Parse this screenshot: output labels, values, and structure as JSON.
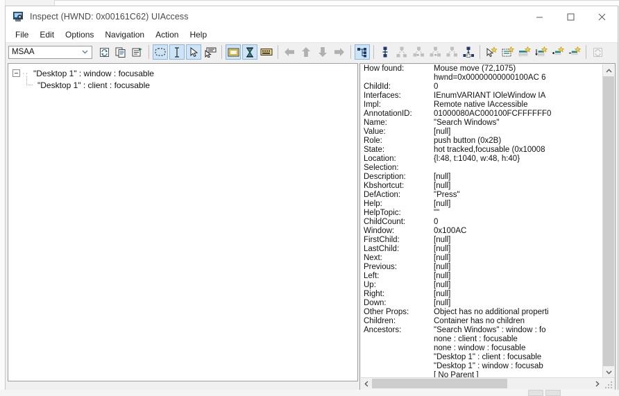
{
  "window": {
    "title": "Inspect  (HWND: 0x00161C62) UIAccess",
    "icon": "inspect-app-icon",
    "controls": {
      "minimize": "minimize-icon",
      "maximize": "maximize-icon",
      "close": "close-icon"
    }
  },
  "menubar": {
    "items": [
      {
        "label": "File"
      },
      {
        "label": "Edit"
      },
      {
        "label": "Options"
      },
      {
        "label": "Navigation"
      },
      {
        "label": "Action"
      },
      {
        "label": "Help"
      }
    ]
  },
  "toolbar": {
    "combo": {
      "value": "MSAA",
      "arrow": "chevron-down-icon"
    },
    "groups": [
      {
        "buttons": [
          {
            "name": "refresh-button",
            "icon": "refresh-icon",
            "checked": false
          },
          {
            "name": "copy-button",
            "icon": "copy-icon",
            "checked": false
          },
          {
            "name": "properties-button",
            "icon": "properties-icon",
            "checked": false
          }
        ]
      },
      {
        "buttons": [
          {
            "name": "watch-rectangle-button",
            "icon": "dotted-rectangle-icon",
            "checked": true
          },
          {
            "name": "watch-caret-button",
            "icon": "caret-icon",
            "checked": true
          },
          {
            "name": "watch-cursor-button",
            "icon": "pointer-icon",
            "checked": true
          },
          {
            "name": "watch-focus-button",
            "icon": "focus-pointer-icon",
            "checked": false
          }
        ]
      },
      {
        "buttons": [
          {
            "name": "highlight-rectangle-button",
            "icon": "highlight-rect-icon",
            "checked": true
          },
          {
            "name": "show-info-tooltip-button",
            "icon": "hourglass-icon",
            "checked": true
          },
          {
            "name": "keyboard-button",
            "icon": "keyboard-icon",
            "checked": false
          }
        ]
      },
      {
        "buttons": [
          {
            "name": "navigate-back-button",
            "icon": "arrow-left-icon",
            "checked": false
          },
          {
            "name": "navigate-up-button",
            "icon": "arrow-up-icon",
            "checked": false
          },
          {
            "name": "navigate-down-button",
            "icon": "arrow-down-icon",
            "checked": false
          },
          {
            "name": "navigate-forward-button",
            "icon": "arrow-right-icon",
            "checked": false
          }
        ]
      },
      {
        "buttons": [
          {
            "name": "tree-view-button",
            "icon": "hierarchy-tree-icon",
            "checked": true
          }
        ]
      },
      {
        "buttons": [
          {
            "name": "nav-parent-button",
            "icon": "node-parent-icon",
            "checked": false
          },
          {
            "name": "nav-children-button",
            "icon": "node-children-icon",
            "checked": false
          },
          {
            "name": "nav-prev-sibling-button",
            "icon": "node-prev-sibling-icon",
            "checked": false
          },
          {
            "name": "nav-next-sibling-button",
            "icon": "node-next-sibling-icon",
            "checked": false
          },
          {
            "name": "nav-descend-button",
            "icon": "node-descend-icon",
            "checked": false
          },
          {
            "name": "nav-first-child-button",
            "icon": "node-first-child-icon",
            "checked": false
          }
        ]
      },
      {
        "buttons": [
          {
            "name": "select-element-button",
            "icon": "pointer-star-icon",
            "checked": false
          },
          {
            "name": "list-elements-button",
            "icon": "list-star-icon",
            "checked": false
          },
          {
            "name": "grid-row-button",
            "icon": "row-star-icon",
            "checked": false
          },
          {
            "name": "grid-column-button",
            "icon": "column-star-icon",
            "checked": false
          },
          {
            "name": "add-row-button",
            "icon": "add-row-star-icon",
            "checked": false
          },
          {
            "name": "remove-row-button",
            "icon": "remove-row-star-icon",
            "checked": false
          },
          {
            "name": "refresh-tree-button",
            "icon": "refresh-disabled-icon",
            "checked": false
          }
        ]
      }
    ]
  },
  "tree": {
    "nodes": [
      {
        "label": "\"Desktop 1\" : window : focusable",
        "level": 1,
        "expanded": true
      },
      {
        "label": "\"Desktop 1\" : client : focusable",
        "level": 2,
        "expanded": false
      }
    ]
  },
  "properties": [
    {
      "key": "How found:",
      "value": "Mouse move (72,1075)"
    },
    {
      "key": "",
      "value": "hwnd=0x00000000000100AC 6"
    },
    {
      "key": "ChildId:",
      "value": "0"
    },
    {
      "key": "Interfaces:",
      "value": "IEnumVARIANT IOleWindow IA"
    },
    {
      "key": "Impl:",
      "value": "Remote native IAccessible"
    },
    {
      "key": "AnnotationID:",
      "value": "01000080AC000100FCFFFFFF0"
    },
    {
      "key": "Name:",
      "value": "\"Search Windows\""
    },
    {
      "key": "Value:",
      "value": "[null]"
    },
    {
      "key": "Role:",
      "value": "push button (0x2B)"
    },
    {
      "key": "State:",
      "value": "hot tracked,focusable (0x10008"
    },
    {
      "key": "Location:",
      "value": "{l:48, t:1040, w:48, h:40}"
    },
    {
      "key": "Selection:",
      "value": ""
    },
    {
      "key": "Description:",
      "value": "[null]"
    },
    {
      "key": "Kbshortcut:",
      "value": "[null]"
    },
    {
      "key": "DefAction:",
      "value": "\"Press\""
    },
    {
      "key": "Help:",
      "value": "[null]"
    },
    {
      "key": "HelpTopic:",
      "value": "\"\""
    },
    {
      "key": "ChildCount:",
      "value": "0"
    },
    {
      "key": "Window:",
      "value": "0x100AC"
    },
    {
      "key": "FirstChild:",
      "value": "[null]"
    },
    {
      "key": "LastChild:",
      "value": "[null]"
    },
    {
      "key": "Next:",
      "value": "[null]"
    },
    {
      "key": "Previous:",
      "value": "[null]"
    },
    {
      "key": "Left:",
      "value": "[null]"
    },
    {
      "key": "Up:",
      "value": "[null]"
    },
    {
      "key": "Right:",
      "value": "[null]"
    },
    {
      "key": "Down:",
      "value": "[null]"
    },
    {
      "key": "Other Props:",
      "value": "Object has no additional properti"
    },
    {
      "key": "Children:",
      "value": "Container has no children"
    },
    {
      "key": "Ancestors:",
      "value": "\"Search Windows\" : window : fo"
    },
    {
      "key": "",
      "value": "none : client : focusable"
    },
    {
      "key": "",
      "value": "none : window : focusable"
    },
    {
      "key": "",
      "value": "\"Desktop 1\" : client : focusable"
    },
    {
      "key": "",
      "value": "\"Desktop 1\" : window : focusab"
    },
    {
      "key": "",
      "value": "[ No Parent ]"
    }
  ],
  "scrollbars": {
    "vertical": {
      "up": "chevron-up-icon",
      "down": "chevron-down-icon"
    },
    "horizontal": {
      "left": "chevron-left-icon",
      "right": "chevron-right-icon"
    }
  },
  "colors": {
    "toolbar_checked": "#cde4f7",
    "window_bg": "#f0f0f0",
    "pane_bg": "#ffffff",
    "scroll_thumb": "#cdcdcd"
  }
}
